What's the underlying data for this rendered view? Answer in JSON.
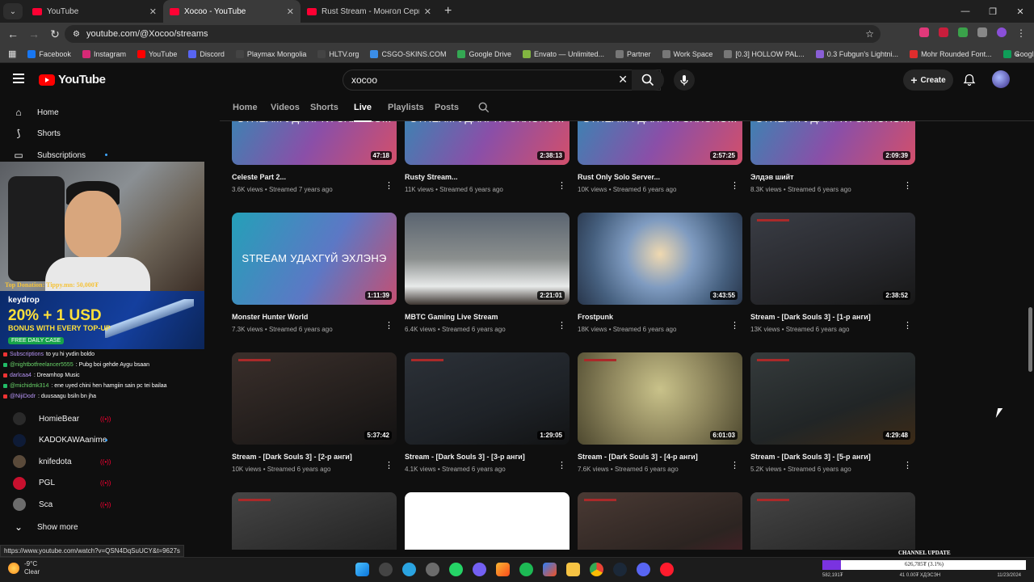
{
  "browser": {
    "tabs": [
      {
        "title": "YouTube",
        "active": false
      },
      {
        "title": "Xocoo - YouTube",
        "active": true
      },
      {
        "title": "Rust Stream - Монгол Серв",
        "active": false
      }
    ],
    "url": "youtube.com/@Xocoo/streams",
    "bookmarks": [
      "Facebook",
      "Instagram",
      "YouTube",
      "Discord",
      "Playmax Mongolia",
      "HLTV.org",
      "CSGO-SKINS.COM",
      "Google Drive",
      "Envato — Unlimited...",
      "Partner",
      "Work Space",
      "[0.3] HOLLOW PAL...",
      "0.3 Fubgun's Lightni...",
      "Mohr Rounded Font...",
      "Google Sheets"
    ]
  },
  "header": {
    "logo": "YouTube",
    "search_value": "xocoo",
    "create_label": "Create"
  },
  "sidebar": {
    "items": [
      {
        "label": "Home",
        "icon": "home-icon"
      },
      {
        "label": "Shorts",
        "icon": "shorts-icon"
      },
      {
        "label": "Subscriptions",
        "icon": "subscriptions-icon"
      }
    ],
    "channels": [
      {
        "label": "HomieBear",
        "status": "live",
        "color": "#2a2a2a"
      },
      {
        "label": "KADOKAWAanime",
        "status": "new",
        "color": "#0e1b36"
      },
      {
        "label": "knifedota",
        "status": "live",
        "color": "#5a4a3a"
      },
      {
        "label": "PGL",
        "status": "live",
        "color": "#c8102e"
      },
      {
        "label": "Sca",
        "status": "live",
        "color": "#6c6c6c"
      }
    ],
    "show_more": "Show more"
  },
  "overlay": {
    "donation": "Top Donation: Tippy.mn: 50,000₮",
    "keydrop_brand": "keydrop",
    "keydrop_big": "20% + 1 USD",
    "keydrop_sub": "BONUS WITH EVERY TOP-UP",
    "keydrop_free": "FREE DAILY CASE",
    "chat": [
      {
        "user": "Subscriptions",
        "msg": "to yu hi yvdin boldo"
      },
      {
        "user": "@nightbotfreelancer5555",
        "msg": ": Pubg boi gehde Aygu bsaan"
      },
      {
        "user": "darlcaa4",
        "msg": ": Dreamhop Music"
      },
      {
        "user": "@michidmk314",
        "msg": ": ene uyed chini hen hamgiin sain pc tei bailaa"
      },
      {
        "user": "@NijiDodr",
        "msg": ": duusaagu bsiln bn jha"
      }
    ]
  },
  "channel_tabs": [
    "Home",
    "Videos",
    "Shorts",
    "Live",
    "Playlists",
    "Posts"
  ],
  "active_tab": "Live",
  "videos": [
    {
      "title": "Celeste Part 2...",
      "views": "3.6K views",
      "age": "Streamed 7 years ago",
      "duration": "47:18",
      "overlay": "STREAM УДАХГҮЙ ЭХЛЭНЭ...",
      "style": "g-stream"
    },
    {
      "title": "Rusty Stream...",
      "views": "11K views",
      "age": "Streamed 6 years ago",
      "duration": "2:38:13",
      "overlay": "STREAM УДАХГҮЙ ЭХЛЭНЭ...",
      "style": "g-stream"
    },
    {
      "title": "Rust Only Solo Server...",
      "views": "10K views",
      "age": "Streamed 6 years ago",
      "duration": "2:57:25",
      "overlay": "STREAM УДАХГҮЙ ЭХЛЭНЭ...",
      "style": "g-stream"
    },
    {
      "title": "Элдэв шийт",
      "views": "8.3K views",
      "age": "Streamed 6 years ago",
      "duration": "2:09:39",
      "overlay": "STREAM УДАХГҮЙ ЭХЛЭНЭ...",
      "style": "g-stream"
    },
    {
      "title": "Monster Hunter World",
      "views": "7.3K views",
      "age": "Streamed 6 years ago",
      "duration": "1:11:39",
      "overlay": "STREAM УДАХГҮЙ ЭХЛЭНЭ",
      "style": "g-mh"
    },
    {
      "title": "MBTC Gaming Live Stream",
      "views": "6.4K views",
      "age": "Streamed 6 years ago",
      "duration": "2:21:01",
      "overlay": "",
      "style": "g-mbtc"
    },
    {
      "title": "Frostpunk",
      "views": "18K views",
      "age": "Streamed 6 years ago",
      "duration": "3:43:55",
      "overlay": "",
      "style": "g-frost"
    },
    {
      "title": "Stream - [Dark Souls 3] - [1-р анги]",
      "views": "13K views",
      "age": "Streamed 6 years ago",
      "duration": "2:38:52",
      "overlay": "",
      "style": "g-ds1"
    },
    {
      "title": "Stream - [Dark Souls 3] - [2-р анги]",
      "views": "10K views",
      "age": "Streamed 6 years ago",
      "duration": "5:37:42",
      "overlay": "",
      "style": "g-ds2"
    },
    {
      "title": "Stream - [Dark Souls 3] - [3-р анги]",
      "views": "4.1K views",
      "age": "Streamed 6 years ago",
      "duration": "1:29:05",
      "overlay": "",
      "style": "g-ds3"
    },
    {
      "title": "Stream - [Dark Souls 3] - [4-р анги]",
      "views": "7.6K views",
      "age": "Streamed 6 years ago",
      "duration": "6:01:03",
      "overlay": "",
      "style": "g-ds4"
    },
    {
      "title": "Stream - [Dark Souls 3] - [5-р анги]",
      "views": "5.2K views",
      "age": "Streamed 6 years ago",
      "duration": "4:29:48",
      "overlay": "",
      "style": "g-ds5"
    },
    {
      "title": "",
      "views": "",
      "age": "",
      "duration": "",
      "overlay": "",
      "style": "g-ds7"
    },
    {
      "title": "",
      "views": "",
      "age": "",
      "duration": "",
      "overlay": "",
      "style": "g-white"
    },
    {
      "title": "",
      "views": "",
      "age": "",
      "duration": "",
      "overlay": "",
      "style": "g-ds6"
    },
    {
      "title": "",
      "views": "",
      "age": "",
      "duration": "",
      "overlay": "",
      "style": "g-ds7"
    }
  ],
  "status_url": "https://www.youtube.com/watch?v=QSN4DqSuUCY&t=9627s",
  "taskbar": {
    "weather_temp": "-9°C",
    "weather_desc": "Clear",
    "channel_update": "CHANNEL UPDATE",
    "progress_text": "626,785₮ (3.1%)",
    "progress_fraction": 0.031,
    "tray_left": "582,191₮",
    "tray_mid": "41 0.00₮ ХДЭСЭН",
    "tray_date": "11/23/2024"
  }
}
